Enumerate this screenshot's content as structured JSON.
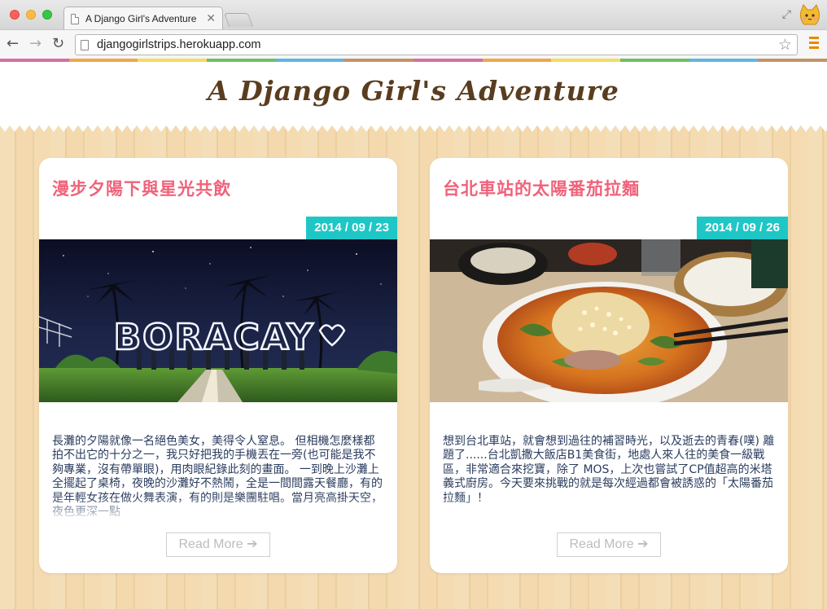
{
  "browser": {
    "tab_title": "A Django Girl's Adventure",
    "tab_close": "✕",
    "url": "djangogirlstrips.herokuapp.com"
  },
  "theme": {
    "accent_pink": "#f0627a",
    "accent_teal": "#1ec7c6",
    "title_brown": "#5a3d1f",
    "rainbow": [
      "#d56ea9",
      "#f1a64a",
      "#f3dd5e",
      "#6cc063",
      "#5fb7e0",
      "#c39466",
      "#d56ea9",
      "#f1a64a",
      "#f3dd5e",
      "#6cc063",
      "#5fb7e0",
      "#c39466"
    ]
  },
  "site": {
    "title": "A Django Girl's Adventure"
  },
  "posts": [
    {
      "title": "漫步夕陽下與星光共飲",
      "date": "2014 / 09 / 23",
      "image_text": "BORACAY",
      "excerpt": "長灘的夕陽就像一名絕色美女，美得令人窒息。 但相機怎麼樣都拍不出它的十分之一，我只好把我的手機丟在一旁(也可能是我不夠專業，沒有帶單眼)，用肉眼紀錄此刻的畫面。 一到晚上沙灘上全擺起了桌椅，夜晚的沙灘好不熱鬧，全是一間間露天餐廳，有的是年輕女孩在做火舞表演，有的則是樂團駐唱。當月亮高掛天空，夜色更深一點",
      "read_more": "Read More"
    },
    {
      "title": "台北車站的太陽番茄拉麵",
      "date": "2014 / 09 / 26",
      "excerpt": "想到台北車站，就會想到過往的補習時光，以及逝去的青春(噗) 離題了......台北凱撒大飯店B1美食街，地處人來人往的美食一級戰區，非常適合來挖寶，除了 MOS，上次也嘗試了CP值超高的米塔義式廚房。今天要來挑戰的就是每次經過都會被誘惑的「太陽番茄拉麵」！",
      "read_more": "Read More"
    }
  ]
}
